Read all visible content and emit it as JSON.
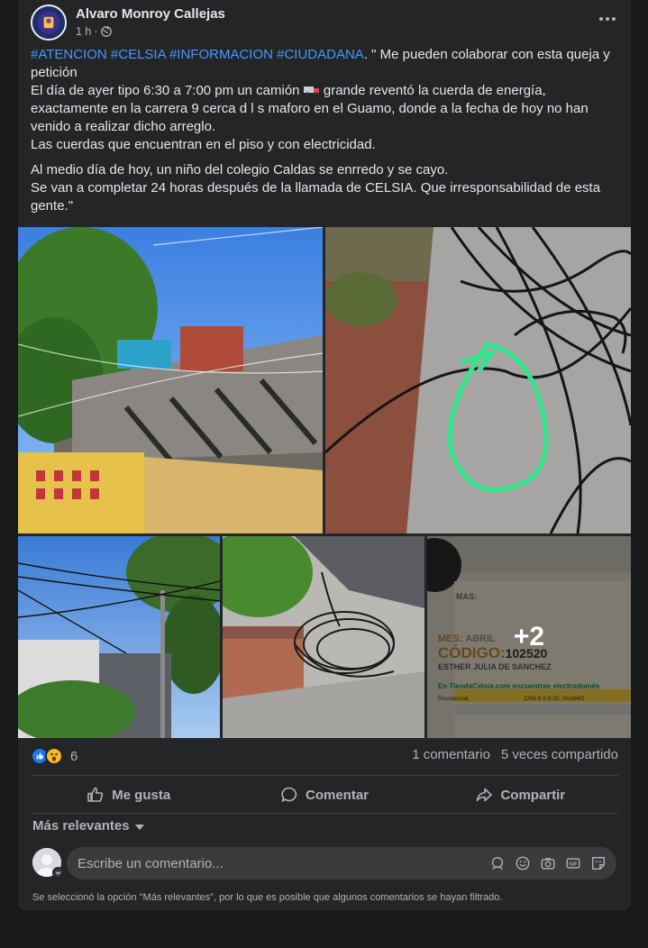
{
  "post": {
    "author": "Alvaro Monroy Callejas",
    "time": "1 h",
    "visibility_icon": "globe-icon",
    "hashtags": "#ATENCION #CELSIA #INFORMACION #CIUDADANA",
    "p1_after_tags": ". \" Me pueden colaborar con esta  queja  y petición",
    "p1_line2_a": "El día de ayer  tipo 6:30 a 7:00 pm un camión",
    "p1_line2_b": " grande reventó la cuerda de energía, exactamente en la carrera 9 cerca d l s maforo en el Guamo, donde a la fecha de hoy no han venido a realizar dicho arreglo.",
    "p1_line3": "Las cuerdas que encuentran en el piso  y con  electricidad.",
    "p2_line1": "Al medio día de hoy, un niño del colegio Caldas  se enrredo y se cayo.",
    "p2_line2": "Se van a completar 24 horas después de la llamada de CELSIA. Que irresponsabilidad de esta gente.\"",
    "more_photos": "+2",
    "receipt": {
      "line_mas": "MAS:",
      "mes": "MES:",
      "mes_value": "ABRIL",
      "codigo": "CÓDIGO:",
      "codigo_value": "102520",
      "name": "ESTHER JULIA DE SANCHEZ",
      "store": "En TiendaCelsia.com encuentras electrodomés",
      "col1": "Residencial",
      "col2": "CRA 9 # 9-20, GUAMO"
    }
  },
  "stats": {
    "reaction_count": "6",
    "comments": "1 comentario",
    "shares": "5 veces compartido"
  },
  "actions": {
    "like": "Me gusta",
    "comment": "Comentar",
    "share": "Compartir"
  },
  "filter": {
    "label": "Más relevantes"
  },
  "composer": {
    "placeholder": "Escribe un comentario..."
  },
  "footer_note": "Se seleccionó la opción \"Más relevantes\", por lo que es posible que algunos comentarios se hayan filtrado.",
  "colors": {
    "background": "#18191a",
    "card": "#242526",
    "hashtag": "#4599ff",
    "like_blue": "#1877f2",
    "highlight_green": "#2ee88a"
  }
}
